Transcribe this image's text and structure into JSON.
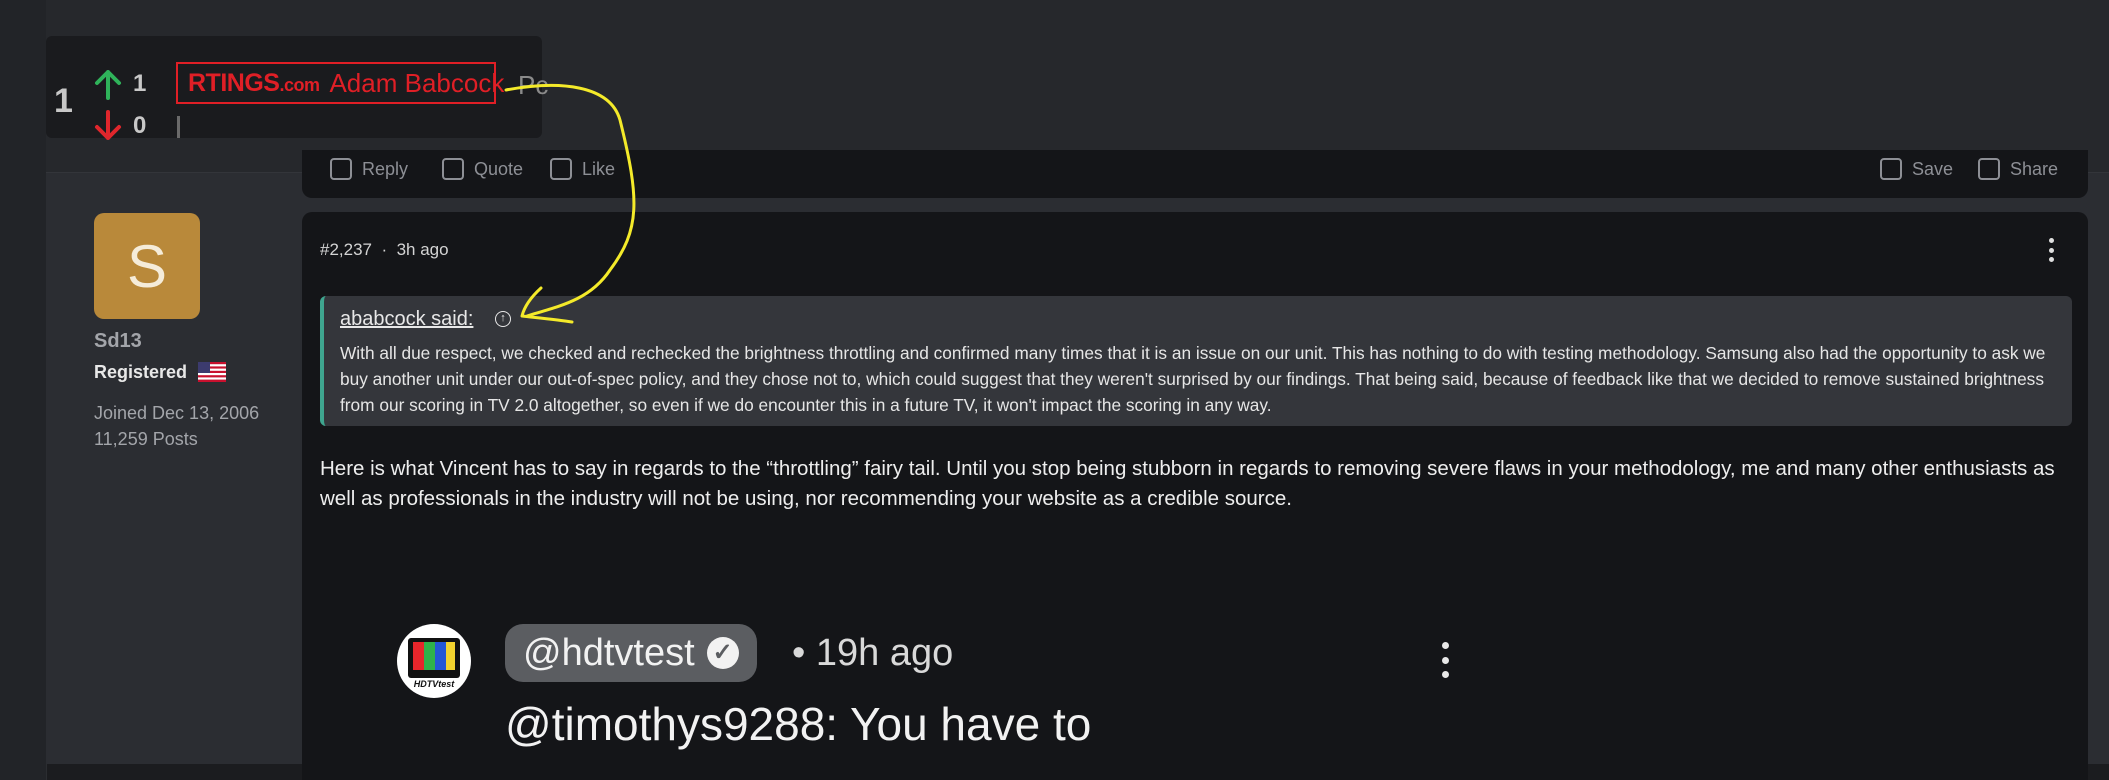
{
  "vote_overlay": {
    "score": "1",
    "upvotes": "1",
    "downvotes": "0",
    "brand": "RTINGS",
    "brand_suffix": ".com",
    "author": "Adam Babcock",
    "trailing_text": "Pc"
  },
  "prev_post_actions": {
    "reply": "Reply",
    "quote": "Quote",
    "like": "Like",
    "save": "Save",
    "share": "Share"
  },
  "user": {
    "avatar_letter": "S",
    "avatar_color": "#b9893a",
    "name": "Sd13",
    "role": "Registered",
    "joined": "Joined Dec 13, 2006",
    "posts": "11,259 Posts"
  },
  "post": {
    "number": "#2,237",
    "time": "3h ago",
    "quote": {
      "author": "ababcock said:",
      "text": "With all due respect, we checked and rechecked the brightness throttling and confirmed many times that it is an issue on our unit. This has nothing to do with testing methodology. Samsung also had the opportunity to ask we buy another unit under our out-of-spec policy, and they chose not to, which could suggest that they weren't surprised by our findings. That being said, because of feedback like that we decided to remove sustained brightness from our scoring in TV 2.0 altogether, so even if we do encounter this in a future TV, it won't impact the scoring in any way."
    },
    "body": "Here is what Vincent has to say in regards to the “throttling” fairy tail. Until you stop being stubborn in regards to removing severe flaws in your methodology, me and many other enthusiasts as well as professionals in the industry will not be using, nor recommending your website as a credible source."
  },
  "embedded_comment": {
    "channel_logo_text": "HDTVtest",
    "handle": "@hdtvtest",
    "time": "• 19h ago",
    "text": "@timothys9288: You have to"
  },
  "colors": {
    "accent_quote": "#3fa58f",
    "upvote": "#2fb35a",
    "downvote": "#e0262c",
    "rtings_red": "#e01f26",
    "annotation": "#f4ea2a"
  }
}
